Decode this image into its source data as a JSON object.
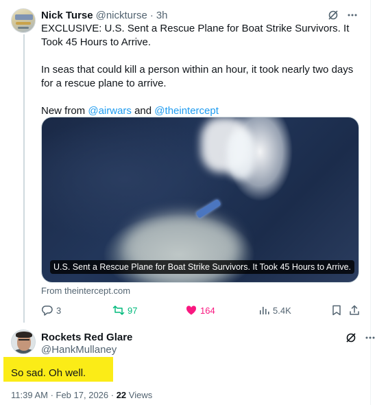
{
  "tweet": {
    "author_name": "Nick Turse",
    "handle": "@nickturse",
    "separator": "·",
    "time": "3h",
    "text_line1": "EXCLUSIVE: U.S. Sent a Rescue Plane for Boat Strike Survivors. It Took 45 Hours to Arrive.",
    "text_line2": "In seas that could kill a person within an hour, it took nearly two days for a rescue plane to arrive.",
    "text_prefix": "New from ",
    "mention1": "@airwars",
    "and": " and ",
    "mention2": "@theintercept",
    "media_caption": "U.S. Sent a Rescue Plane for Boat Strike Survivors. It Took 45 Hours to Arrive.",
    "source": "From theintercept.com",
    "replies": "3",
    "retweets": "97",
    "likes": "164",
    "views": "5.4K",
    "like_color": "#f91880",
    "retweet_color": "#00ba7c",
    "link_color": "#1d9bf0"
  },
  "reply": {
    "author_name": "Rockets Red Glare",
    "handle": "@HankMullaney",
    "text": "So sad. Oh well.",
    "time_date": "11:39 AM · Feb 17, 2026 · ",
    "views_count": "22",
    "views_label": " Views",
    "highlight_color": "#fbec17"
  },
  "icons": {
    "grok": "grok-icon",
    "more": "more-icon",
    "reply": "reply-icon",
    "retweet": "retweet-icon",
    "like": "heart-icon",
    "views": "views-icon",
    "bookmark": "bookmark-icon",
    "share": "share-icon"
  }
}
